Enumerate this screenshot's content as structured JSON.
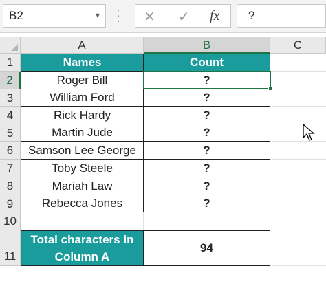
{
  "formula_bar": {
    "name_box": "B2",
    "cancel_glyph": "✕",
    "enter_glyph": "✓",
    "fx_glyph": "fx",
    "formula_text": "?"
  },
  "columns": [
    "A",
    "B",
    "C"
  ],
  "rows": [
    "1",
    "2",
    "3",
    "4",
    "5",
    "6",
    "7",
    "8",
    "9",
    "10",
    "11"
  ],
  "table": {
    "headers": [
      "Names",
      "Count"
    ],
    "names": [
      "Roger Bill",
      "William Ford",
      "Rick Hardy",
      "Martin Jude",
      "Samson Lee George",
      "Toby Steele",
      "Mariah Law",
      "Rebecca Jones"
    ],
    "counts": [
      "?",
      "?",
      "?",
      "?",
      "?",
      "?",
      "?",
      "?"
    ],
    "total_label": "Total characters in Column A",
    "total_value": "94"
  },
  "selected_cell": "B2",
  "colors": {
    "header_fill": "#1a9c9c",
    "selection": "#217346"
  }
}
